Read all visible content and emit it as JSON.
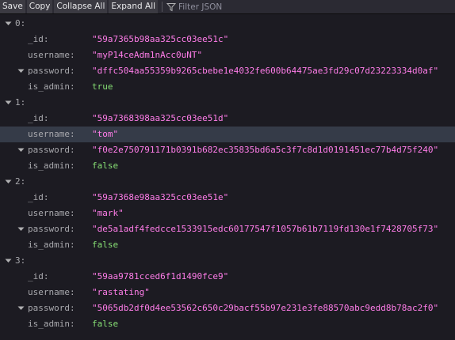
{
  "toolbar": {
    "save": "Save",
    "copy": "Copy",
    "collapse_all": "Collapse All",
    "expand_all": "Expand All",
    "filter_placeholder": "Filter JSON"
  },
  "keys": {
    "id": "_id:",
    "username": "username:",
    "password": "password:",
    "is_admin": "is_admin:"
  },
  "records": [
    {
      "index": "0:",
      "id": "\"59a7365b98aa325cc03ee51c\"",
      "username": "\"myP14ceAdm1nAcc0uNT\"",
      "password": "\"dffc504aa55359b9265cbebe1e4032fe600b64475ae3fd29c07d23223334d0af\"",
      "is_admin": "true"
    },
    {
      "index": "1:",
      "id": "\"59a7368398aa325cc03ee51d\"",
      "username": "\"tom\"",
      "password": "\"f0e2e750791171b0391b682ec35835bd6a5c3f7c8d1d0191451ec77b4d75f240\"",
      "is_admin": "false"
    },
    {
      "index": "2:",
      "id": "\"59a7368e98aa325cc03ee51e\"",
      "username": "\"mark\"",
      "password": "\"de5a1adf4fedcce1533915edc60177547f1057b61b7119fd130e1f7428705f73\"",
      "is_admin": "false"
    },
    {
      "index": "3:",
      "id": "\"59aa9781cced6f1d1490fce9\"",
      "username": "\"rastating\"",
      "password": "\"5065db2df0d4ee53562c650c29bacf55b97e231e3fe88570abc9edd8b78ac2f0\"",
      "is_admin": "false"
    }
  ],
  "colors": {
    "background": "#1c1b22",
    "string": "#ff7de9",
    "boolean": "#86de74",
    "selected_row": "#353b48"
  },
  "icons": {
    "expander": "chevron-down-icon",
    "filter": "funnel-icon"
  }
}
